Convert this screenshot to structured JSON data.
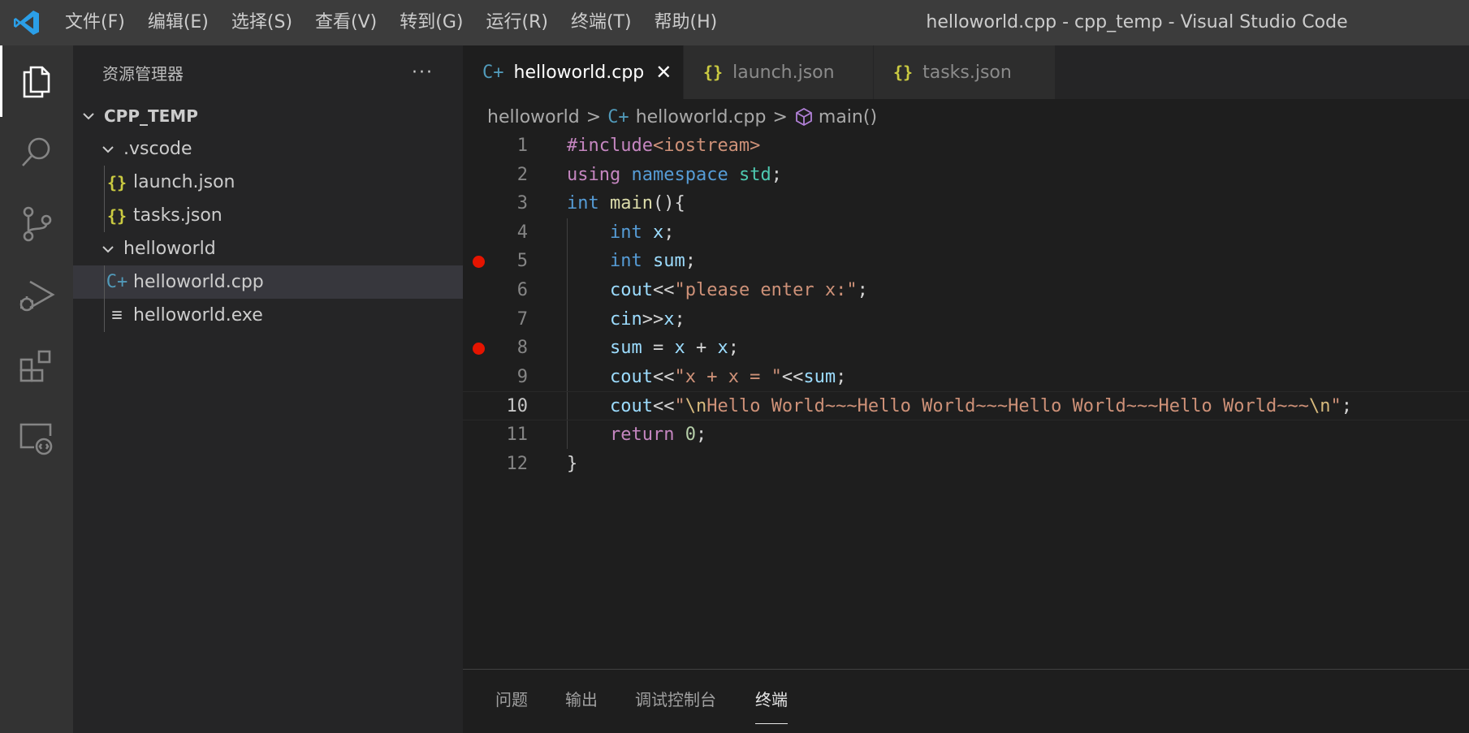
{
  "titlebar": {
    "menu": [
      "文件(F)",
      "编辑(E)",
      "选择(S)",
      "查看(V)",
      "转到(G)",
      "运行(R)",
      "终端(T)",
      "帮助(H)"
    ],
    "window_title": "helloworld.cpp - cpp_temp - Visual Studio Code"
  },
  "activity_bar": {
    "icons": [
      "explorer-icon",
      "search-icon",
      "source-control-icon",
      "run-debug-icon",
      "extensions-icon",
      "remote-explorer-icon"
    ]
  },
  "sidebar": {
    "title": "资源管理器",
    "more": "···",
    "tree": [
      {
        "label": "CPP_TEMP",
        "kind": "root-folder",
        "expanded": true
      },
      {
        "label": ".vscode",
        "kind": "folder",
        "expanded": true
      },
      {
        "label": "launch.json",
        "kind": "json-file",
        "icon": "{}"
      },
      {
        "label": "tasks.json",
        "kind": "json-file",
        "icon": "{}"
      },
      {
        "label": "helloworld",
        "kind": "folder",
        "expanded": true
      },
      {
        "label": "helloworld.cpp",
        "kind": "cpp-file",
        "icon": "C+",
        "selected": true
      },
      {
        "label": "helloworld.exe",
        "kind": "binary-file",
        "icon": "≡"
      }
    ]
  },
  "tabs": [
    {
      "label": "helloworld.cpp",
      "icon": "C+",
      "active": true,
      "close": "✕"
    },
    {
      "label": "launch.json",
      "icon": "{}",
      "active": false
    },
    {
      "label": "tasks.json",
      "icon": "{}",
      "active": false
    }
  ],
  "breadcrumb": {
    "items": [
      "helloworld",
      "helloworld.cpp",
      "main()"
    ],
    "separator": ">"
  },
  "editor": {
    "current_line": 10,
    "breakpoints": [
      5,
      8
    ],
    "lines": [
      [
        [
          "#include",
          "pp"
        ],
        [
          "<iostream>",
          "inc"
        ]
      ],
      [
        [
          "using",
          "ctl"
        ],
        [
          " ",
          "pn"
        ],
        [
          "namespace",
          "kw"
        ],
        [
          " ",
          "pn"
        ],
        [
          "std",
          "ns"
        ],
        [
          ";",
          "pn"
        ]
      ],
      [
        [
          "int",
          "kw"
        ],
        [
          " ",
          "pn"
        ],
        [
          "main",
          "fn"
        ],
        [
          "(){",
          "pn"
        ]
      ],
      [
        [
          "    ",
          "pn"
        ],
        [
          "int",
          "kw"
        ],
        [
          " ",
          "pn"
        ],
        [
          "x",
          "var"
        ],
        [
          ";",
          "pn"
        ]
      ],
      [
        [
          "    ",
          "pn"
        ],
        [
          "int",
          "kw"
        ],
        [
          " ",
          "pn"
        ],
        [
          "sum",
          "var"
        ],
        [
          ";",
          "pn"
        ]
      ],
      [
        [
          "    ",
          "pn"
        ],
        [
          "cout",
          "var"
        ],
        [
          "<<",
          "pn"
        ],
        [
          "\"please enter x:\"",
          "str"
        ],
        [
          ";",
          "pn"
        ]
      ],
      [
        [
          "    ",
          "pn"
        ],
        [
          "cin",
          "var"
        ],
        [
          ">>",
          "pn"
        ],
        [
          "x",
          "var"
        ],
        [
          ";",
          "pn"
        ]
      ],
      [
        [
          "    ",
          "pn"
        ],
        [
          "sum",
          "var"
        ],
        [
          " = ",
          "pn"
        ],
        [
          "x",
          "var"
        ],
        [
          " + ",
          "pn"
        ],
        [
          "x",
          "var"
        ],
        [
          ";",
          "pn"
        ]
      ],
      [
        [
          "    ",
          "pn"
        ],
        [
          "cout",
          "var"
        ],
        [
          "<<",
          "pn"
        ],
        [
          "\"x + x = \"",
          "str"
        ],
        [
          "<<",
          "pn"
        ],
        [
          "sum",
          "var"
        ],
        [
          ";",
          "pn"
        ]
      ],
      [
        [
          "    ",
          "pn"
        ],
        [
          "cout",
          "var"
        ],
        [
          "<<",
          "pn"
        ],
        [
          "\"",
          "str"
        ],
        [
          "\\n",
          "esc"
        ],
        [
          "Hello World~~~Hello World~~~Hello World~~~Hello World~~~",
          "str"
        ],
        [
          "\\n",
          "esc"
        ],
        [
          "\"",
          "str"
        ],
        [
          ";",
          "pn"
        ]
      ],
      [
        [
          "    ",
          "pn"
        ],
        [
          "return",
          "ctl"
        ],
        [
          " ",
          "pn"
        ],
        [
          "0",
          "num"
        ],
        [
          ";",
          "pn"
        ]
      ],
      [
        [
          "}",
          "pn"
        ]
      ]
    ]
  },
  "panel": {
    "tabs": [
      {
        "label": "问题",
        "active": false
      },
      {
        "label": "输出",
        "active": false
      },
      {
        "label": "调试控制台",
        "active": false
      },
      {
        "label": "终端",
        "active": true
      }
    ]
  },
  "colors": {
    "accent": "#007acc",
    "breakpoint": "#e51400",
    "json_icon": "#cbcb41",
    "cpp_icon": "#519aba"
  }
}
